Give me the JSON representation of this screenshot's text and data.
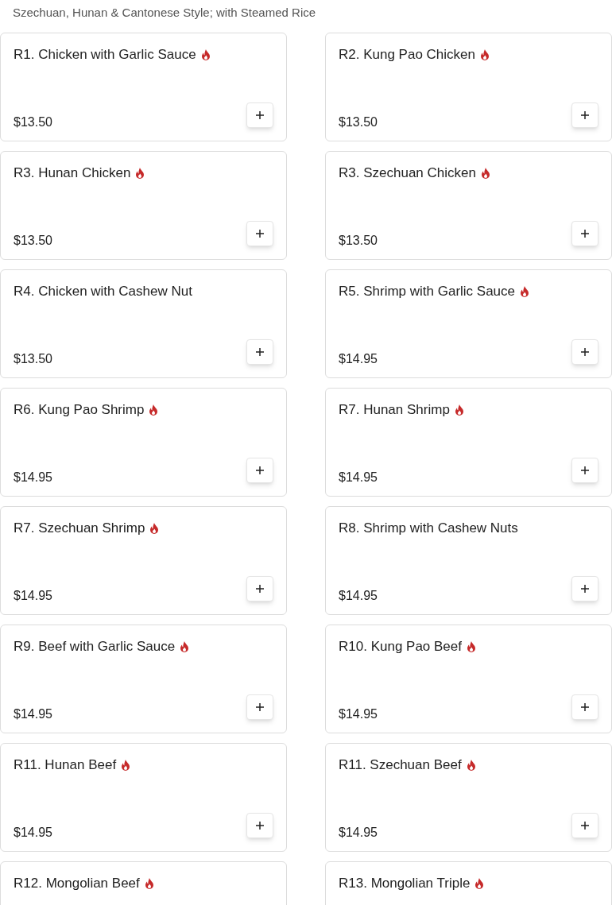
{
  "subtitle": "Szechuan, Hunan & Cantonese Style; with Steamed Rice",
  "items": [
    {
      "name": "R1. Chicken with Garlic Sauce",
      "spicy": true,
      "price": "$13.50"
    },
    {
      "name": "R2. Kung Pao Chicken",
      "spicy": true,
      "price": "$13.50"
    },
    {
      "name": "R3. Hunan Chicken",
      "spicy": true,
      "price": "$13.50"
    },
    {
      "name": "R3. Szechuan Chicken",
      "spicy": true,
      "price": "$13.50"
    },
    {
      "name": "R4. Chicken with Cashew Nut",
      "spicy": false,
      "price": "$13.50"
    },
    {
      "name": "R5. Shrimp with Garlic Sauce",
      "spicy": true,
      "price": "$14.95"
    },
    {
      "name": "R6. Kung Pao Shrimp",
      "spicy": true,
      "price": "$14.95"
    },
    {
      "name": "R7. Hunan Shrimp",
      "spicy": true,
      "price": "$14.95"
    },
    {
      "name": "R7. Szechuan Shrimp",
      "spicy": true,
      "price": "$14.95"
    },
    {
      "name": "R8. Shrimp with Cashew Nuts",
      "spicy": false,
      "price": "$14.95"
    },
    {
      "name": "R9. Beef with Garlic Sauce",
      "spicy": true,
      "price": "$14.95"
    },
    {
      "name": "R10. Kung Pao Beef",
      "spicy": true,
      "price": "$14.95"
    },
    {
      "name": "R11. Hunan Beef",
      "spicy": true,
      "price": "$14.95"
    },
    {
      "name": "R11. Szechuan Beef",
      "spicy": true,
      "price": "$14.95"
    },
    {
      "name": "R12. Mongolian Beef",
      "spicy": true
    },
    {
      "name": "R13. Mongolian Triple",
      "spicy": true
    }
  ]
}
